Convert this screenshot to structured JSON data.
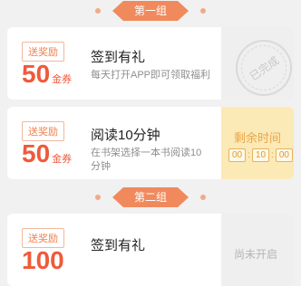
{
  "groups": [
    {
      "label": "第一组",
      "tasks": [
        {
          "badge": "送奖励",
          "amount": "50",
          "unit": "金券",
          "title": "签到有礼",
          "desc": "每天打开APP即可领取福利",
          "status": "已完成"
        },
        {
          "badge": "送奖励",
          "amount": "50",
          "unit": "金券",
          "title": "阅读10分钟",
          "desc": "在书架选择一本书阅读10分钟",
          "status_label": "剩余时间",
          "countdown": [
            "00",
            "10",
            "00"
          ]
        }
      ]
    },
    {
      "label": "第二组",
      "tasks": [
        {
          "badge": "送奖励",
          "amount": "100",
          "title": "签到有礼",
          "status": "尚未开启"
        }
      ]
    }
  ]
}
